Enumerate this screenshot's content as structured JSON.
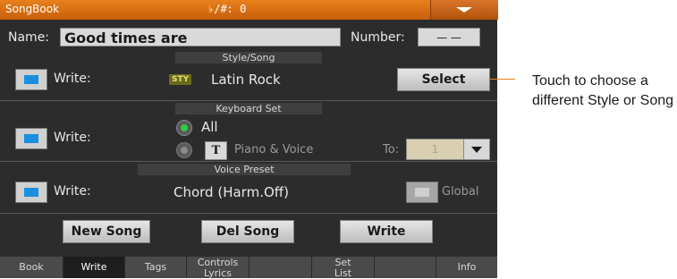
{
  "title_bar": {
    "title": "SongBook",
    "transpose": "♭/#: 0"
  },
  "header": {
    "name_label": "Name:",
    "name_value": "Good times are",
    "number_label": "Number:",
    "number_value": "— —"
  },
  "style_song": {
    "heading": "Style/Song",
    "write_label": "Write:",
    "badge": "STY",
    "value": "Latin Rock",
    "select_label": "Select"
  },
  "keyboard_set": {
    "heading": "Keyboard Set",
    "write_label": "Write:",
    "all_label": "All",
    "t_badge": "T",
    "piano_voice_label": "Piano & Voice",
    "to_label": "To:",
    "to_value": "1"
  },
  "voice_preset": {
    "heading": "Voice Preset",
    "write_label": "Write:",
    "value": "Chord (Harm.Off)",
    "global_label": "Global"
  },
  "actions": {
    "new_song": "New Song",
    "del_song": "Del Song",
    "write": "Write"
  },
  "tabs": [
    {
      "label": "Book"
    },
    {
      "label": "Write",
      "active": true
    },
    {
      "label": "Tags"
    },
    {
      "line1": "Controls",
      "line2": "Lyrics"
    },
    {
      "label": ""
    },
    {
      "line1": "Set",
      "line2": "List"
    },
    {
      "label": ""
    },
    {
      "label": "Info"
    }
  ],
  "annotation": "Touch to choose a different Style or Song",
  "colors": {
    "title_bar": "#e8801c",
    "checkbox_on": "#1a8fe0",
    "radio_on": "#2ecc40"
  }
}
